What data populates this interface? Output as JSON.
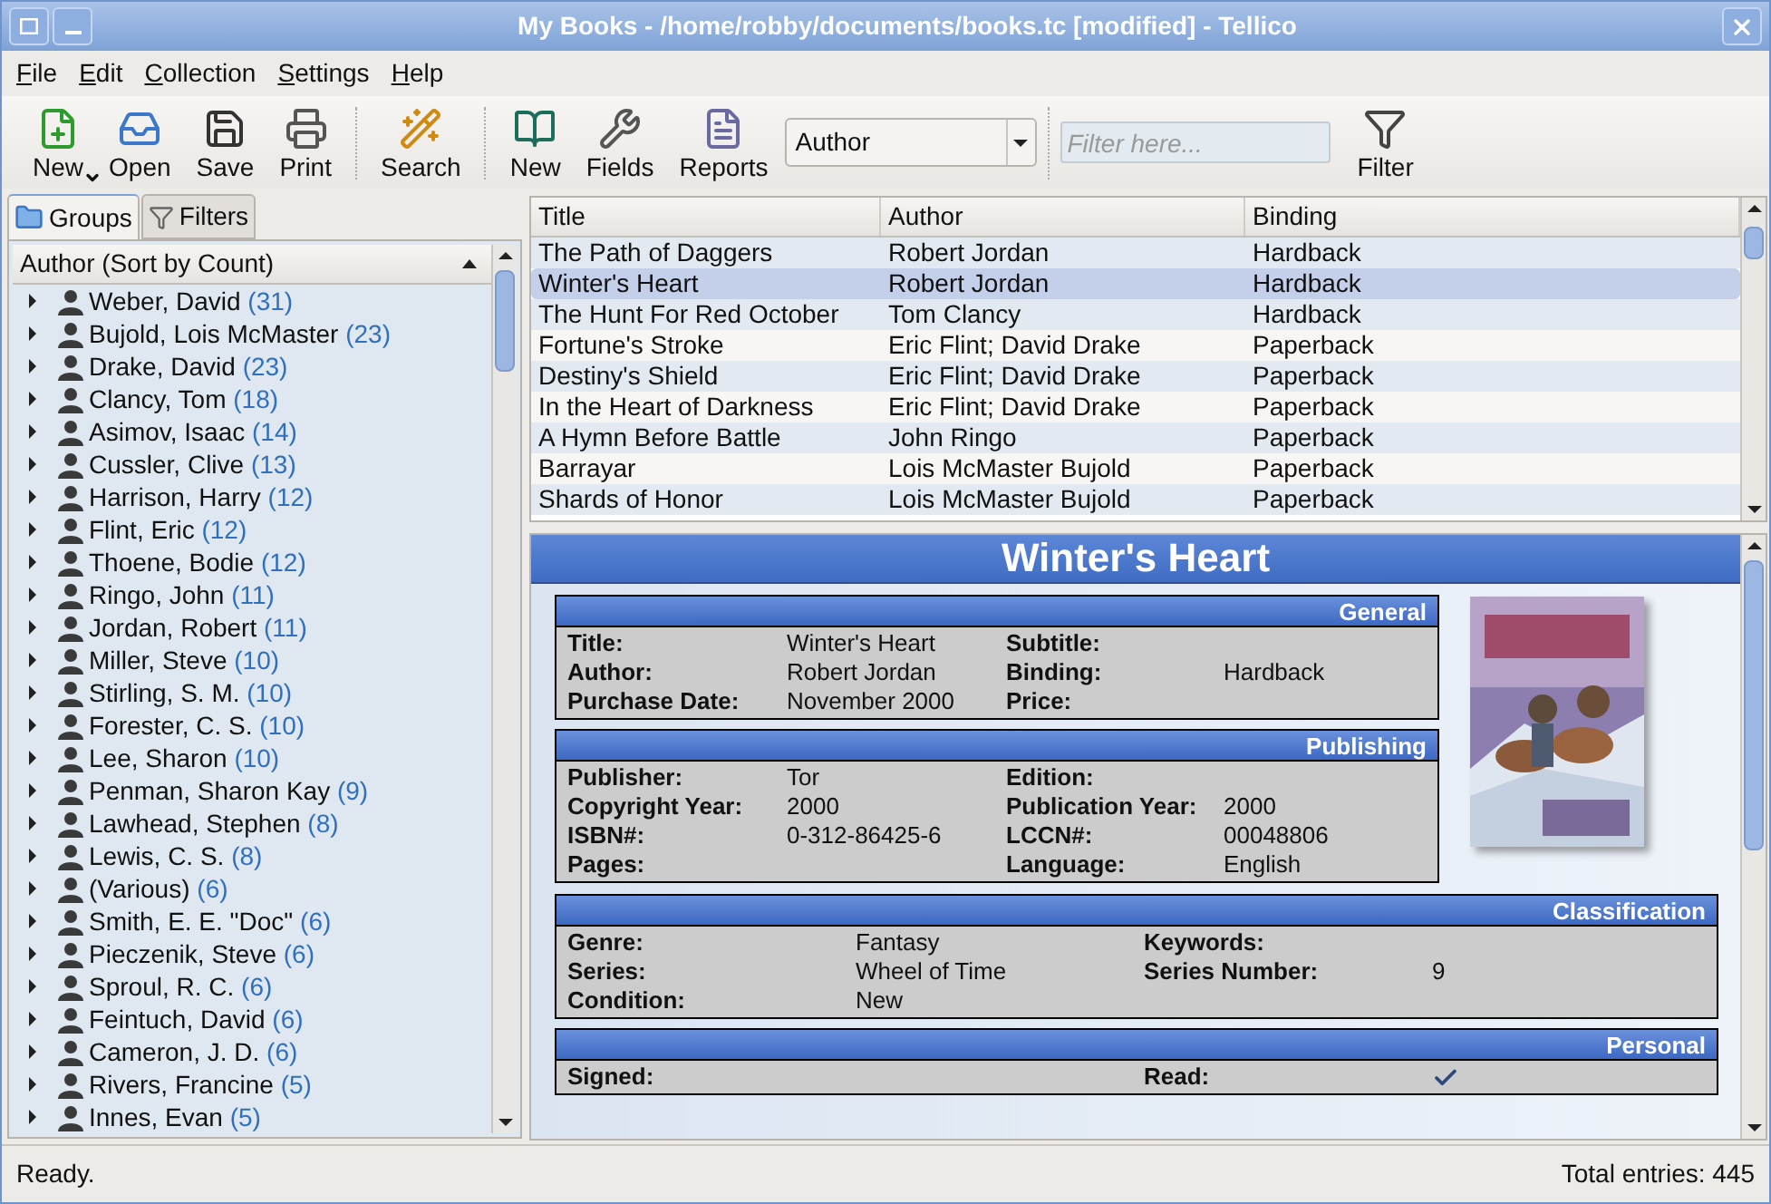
{
  "window": {
    "title": "My Books - /home/robby/documents/books.tc [modified] - Tellico"
  },
  "menu": [
    "File",
    "Edit",
    "Collection",
    "Settings",
    "Help"
  ],
  "toolbar": [
    {
      "kind": "button",
      "label": "New",
      "dropdown": true
    },
    {
      "kind": "button",
      "label": "Open",
      "dropdown": false
    },
    {
      "kind": "button",
      "label": "Save",
      "dropdown": false
    },
    {
      "kind": "button",
      "label": "Print",
      "dropdown": false
    },
    {
      "kind": "separator"
    },
    {
      "kind": "button",
      "label": "Search",
      "dropdown": false
    },
    {
      "kind": "separator"
    },
    {
      "kind": "button",
      "label": "New",
      "dropdown": false
    },
    {
      "kind": "button",
      "label": "Fields",
      "dropdown": false
    },
    {
      "kind": "button",
      "label": "Reports",
      "dropdown": false
    },
    {
      "kind": "combo",
      "value": "Author"
    },
    {
      "kind": "separator"
    },
    {
      "kind": "search",
      "placeholder": "Filter here..."
    },
    {
      "kind": "button",
      "label": "Filter",
      "dropdown": false
    }
  ],
  "tabs": [
    {
      "label": "Groups",
      "selected": true
    },
    {
      "label": "Filters",
      "selected": false
    }
  ],
  "group_tree": {
    "header": "Author (Sort by Count)",
    "items": [
      {
        "name": "Weber, David",
        "count": "(31)",
        "expanded": false
      },
      {
        "name": "Bujold, Lois McMaster",
        "count": "(23)",
        "expanded": false
      },
      {
        "name": "Drake, David",
        "count": "(23)",
        "expanded": false
      },
      {
        "name": "Clancy, Tom",
        "count": "(18)",
        "expanded": false
      },
      {
        "name": "Asimov, Isaac",
        "count": "(14)",
        "expanded": false
      },
      {
        "name": "Cussler, Clive",
        "count": "(13)",
        "expanded": false
      },
      {
        "name": "Harrison, Harry",
        "count": "(12)",
        "expanded": false
      },
      {
        "name": "Flint, Eric",
        "count": "(12)",
        "expanded": false
      },
      {
        "name": "Thoene, Bodie",
        "count": "(12)",
        "expanded": false
      },
      {
        "name": "Ringo, John",
        "count": "(11)",
        "expanded": false
      },
      {
        "name": "Jordan, Robert",
        "count": "(11)",
        "expanded": false
      },
      {
        "name": "Miller, Steve",
        "count": "(10)",
        "expanded": false
      },
      {
        "name": "Stirling, S. M.",
        "count": "(10)",
        "expanded": false
      },
      {
        "name": "Forester, C. S.",
        "count": "(10)",
        "expanded": false
      },
      {
        "name": "Lee, Sharon",
        "count": "(10)",
        "expanded": false
      },
      {
        "name": "Penman, Sharon Kay",
        "count": "(9)",
        "expanded": false
      },
      {
        "name": "Lawhead, Stephen",
        "count": "(8)",
        "expanded": false
      },
      {
        "name": "Lewis, C. S.",
        "count": "(8)",
        "expanded": false
      },
      {
        "name": "(Various)",
        "count": "(6)",
        "expanded": false
      },
      {
        "name": "Smith, E. E. \"Doc\"",
        "count": "(6)",
        "expanded": false
      },
      {
        "name": "Pieczenik, Steve",
        "count": "(6)",
        "expanded": false
      },
      {
        "name": "Sproul, R. C.",
        "count": "(6)",
        "expanded": false
      },
      {
        "name": "Feintuch, David",
        "count": "(6)",
        "expanded": false
      },
      {
        "name": "Cameron, J. D.",
        "count": "(6)",
        "expanded": false
      },
      {
        "name": "Rivers, Francine",
        "count": "(5)",
        "expanded": false
      },
      {
        "name": "Innes, Evan",
        "count": "(5)",
        "expanded": false
      }
    ]
  },
  "table": {
    "columns": [
      "Title",
      "Author",
      "Binding"
    ],
    "rows": [
      {
        "cells": [
          "The Path of Daggers",
          "Robert Jordan",
          "Hardback"
        ],
        "selected": false
      },
      {
        "cells": [
          "Winter's Heart",
          "Robert Jordan",
          "Hardback"
        ],
        "selected": true
      },
      {
        "cells": [
          "The Hunt For Red October",
          "Tom Clancy",
          "Hardback"
        ],
        "selected": false
      },
      {
        "cells": [
          "Fortune's Stroke",
          "Eric Flint; David Drake",
          "Paperback"
        ],
        "selected": false
      },
      {
        "cells": [
          "Destiny's Shield",
          "Eric Flint; David Drake",
          "Paperback"
        ],
        "selected": false
      },
      {
        "cells": [
          "In the Heart of Darkness",
          "Eric Flint; David Drake",
          "Paperback"
        ],
        "selected": false
      },
      {
        "cells": [
          "A Hymn Before Battle",
          "John Ringo",
          "Paperback"
        ],
        "selected": false
      },
      {
        "cells": [
          "Barrayar",
          "Lois McMaster Bujold",
          "Paperback"
        ],
        "selected": false
      },
      {
        "cells": [
          "Shards of Honor",
          "Lois McMaster Bujold",
          "Paperback"
        ],
        "selected": false
      }
    ]
  },
  "detail": {
    "title": "Winter's Heart",
    "sections": [
      {
        "title": "General",
        "rows": [
          [
            {
              "label": "Title:",
              "value": "Winter's Heart"
            },
            {
              "label": "Subtitle:"
            }
          ],
          [
            {
              "label": "Author:",
              "value": "Robert Jordan"
            },
            {
              "label": "Binding:",
              "value": "Hardback"
            }
          ],
          [
            {
              "label": "Purchase Date:",
              "value": "November 2000"
            },
            {
              "label": "Price:"
            }
          ]
        ]
      },
      {
        "title": "Publishing",
        "rows": [
          [
            {
              "label": "Publisher:",
              "value": "Tor"
            },
            {
              "label": "Edition:"
            }
          ],
          [
            {
              "label": "Copyright Year:",
              "value": "2000"
            },
            {
              "label": "Publication Year:",
              "value": "2000"
            }
          ],
          [
            {
              "label": "ISBN#:",
              "value": "0-312-86425-6"
            },
            {
              "label": "LCCN#:",
              "value": "00048806"
            }
          ],
          [
            {
              "label": "Pages:"
            },
            {
              "label": "Language:",
              "value": "English"
            }
          ]
        ]
      },
      {
        "title": "Classification",
        "rows": [
          [
            {
              "label": "Genre:",
              "value": "Fantasy"
            },
            {
              "label": "Keywords:"
            }
          ],
          [
            {
              "label": "Series:",
              "value": "Wheel of Time"
            },
            {
              "label": "Series Number:",
              "value": "9"
            }
          ],
          [
            {
              "label": "Condition:",
              "value": "New"
            }
          ]
        ]
      },
      {
        "title": "Personal",
        "rows": [
          [
            {
              "label": "Signed:",
              "kind": "check",
              "checked": false
            },
            {
              "label": "Read:",
              "kind": "check",
              "checked": true
            }
          ]
        ]
      }
    ]
  },
  "status_bar": {
    "message": "Ready.",
    "total": "Total entries: 445"
  }
}
